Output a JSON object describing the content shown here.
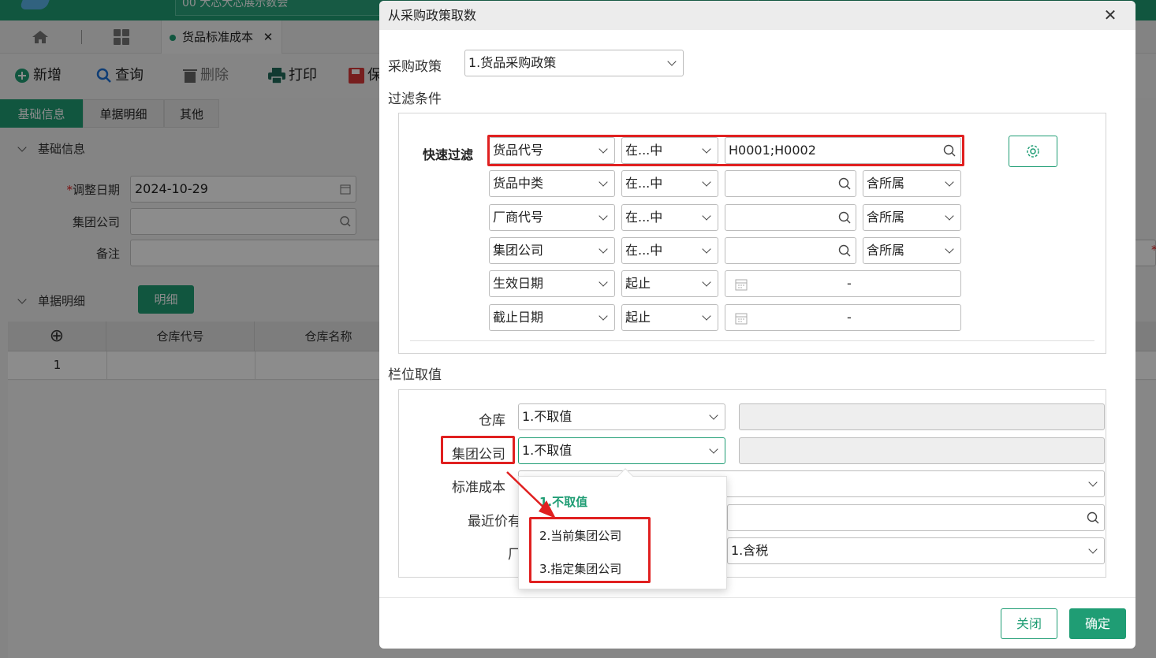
{
  "app": {
    "title_partial": "00 大芯大芯展示数会",
    "tab_label": "货品标准成本",
    "toolbar": {
      "add": "新增",
      "query": "查询",
      "delete": "删除",
      "print": "打印",
      "save_partial": "保"
    },
    "subtabs": [
      "基础信息",
      "单据明细",
      "其他"
    ],
    "basic_section": "基础信息",
    "fields": {
      "date_label": "调整日期",
      "date_value": "2024-10-29",
      "group_label": "集团公司",
      "group_value": "",
      "remark_label": "备注",
      "remark_value": ""
    },
    "detail_section": "单据明细",
    "detail_button": "明细",
    "grid": {
      "add_symbol": "⊕",
      "columns": [
        "仓库代号",
        "仓库名称"
      ],
      "row_num": "1"
    },
    "required_mark": "*"
  },
  "dialog": {
    "title": "从采购政策取数",
    "close": "✕",
    "policy_label": "采购政策",
    "policy_value": "1.货品采购政策",
    "filter_section": "过滤条件",
    "quick_filter_label": "快速过滤",
    "filters": [
      {
        "field": "货品代号",
        "op": "在...中",
        "value": "H0001;H0002"
      },
      {
        "field": "货品中类",
        "op": "在...中",
        "value": "",
        "scope": "含所属"
      },
      {
        "field": "厂商代号",
        "op": "在...中",
        "value": "",
        "scope": "含所属"
      },
      {
        "field": "集团公司",
        "op": "在...中",
        "value": "",
        "scope": "含所属"
      },
      {
        "field": "生效日期",
        "op": "起止",
        "range_sep": "-"
      },
      {
        "field": "截止日期",
        "op": "起止",
        "range_sep": "-"
      }
    ],
    "column_section": "栏位取值",
    "columns": [
      {
        "label": "仓库",
        "value": "1.不取值"
      },
      {
        "label": "集团公司",
        "value": "1.不取值"
      },
      {
        "label": "标准成本",
        "value": ""
      },
      {
        "label": "最近价有",
        "value": ""
      },
      {
        "label": "厂",
        "value": "1.含税"
      }
    ],
    "dropdown_options": [
      "1.不取值",
      "2.当前集团公司",
      "3.指定集团公司"
    ],
    "close_button": "关闭",
    "confirm_button": "确定"
  },
  "colors": {
    "accent": "#1f9d74",
    "highlight": "#e02020"
  }
}
